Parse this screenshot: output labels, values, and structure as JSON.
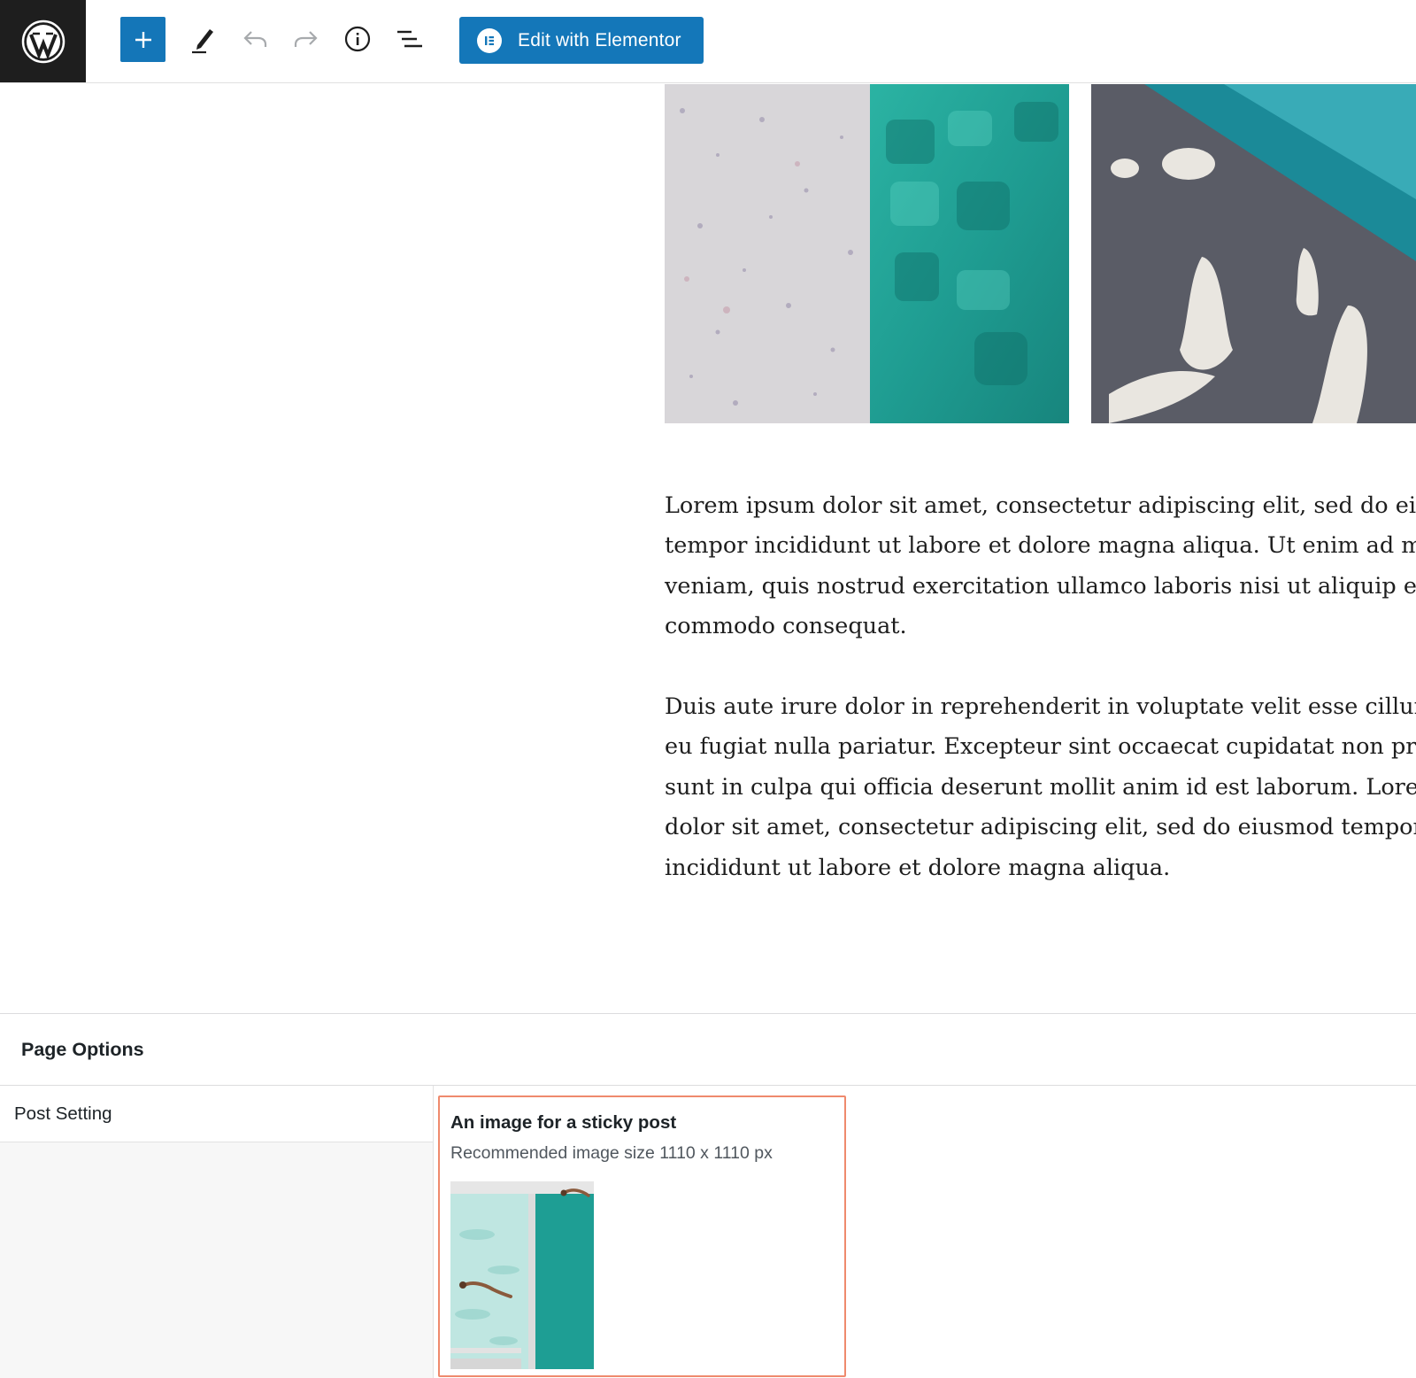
{
  "toolbar": {
    "elementor_label": "Edit with Elementor"
  },
  "content": {
    "paragraph1": [
      "Lorem ipsum dolor sit amet, consectetur adipiscing elit, sed do eiusm",
      "tempor incididunt ut labore et dolore magna aliqua. Ut enim ad mini",
      "veniam, quis nostrud exercitation ullamco laboris nisi ut aliquip ex e",
      "commodo consequat."
    ],
    "paragraph2": [
      "Duis aute irure dolor in reprehenderit in voluptate velit esse cillum d",
      "eu fugiat nulla pariatur. Excepteur sint occaecat cupidatat non proide",
      "sunt in culpa qui officia deserunt mollit anim id est laborum. Lorem i",
      "dolor sit amet, consectetur adipiscing elit, sed do eiusmod tempor",
      "incididunt ut labore et dolore magna aliqua."
    ]
  },
  "page_options": {
    "title": "Page Options",
    "tab_label": "Post Setting",
    "field": {
      "title": "An image for a sticky post",
      "description": "Recommended image size 1110 x 1110 px"
    }
  },
  "colors": {
    "accent": "#1476b8",
    "highlight_border": "#ef8a6d"
  }
}
